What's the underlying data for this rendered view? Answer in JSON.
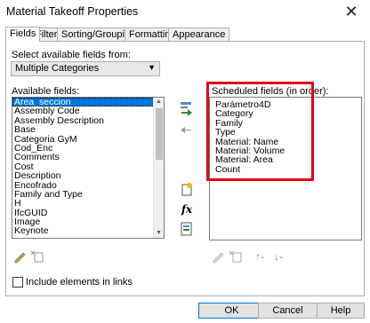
{
  "window": {
    "title": "Material Takeoff Properties",
    "close_glyph": "✕"
  },
  "tabs": [
    {
      "label": "Fields"
    },
    {
      "label": "Filter"
    },
    {
      "label": "Sorting/Grouping"
    },
    {
      "label": "Formatting"
    },
    {
      "label": "Appearance"
    }
  ],
  "fields": {
    "select_label": "Select available fields from:",
    "select_value": "Multiple Categories",
    "available_label": "Available fields:",
    "available_items": [
      "Area_seccion",
      "Assembly Code",
      "Assembly Description",
      "Base",
      "Categoria GyM",
      "Cod_Enc",
      "Comments",
      "Cost",
      "Description",
      "Encofrado",
      "Family and Type",
      "H",
      "IfcGUID",
      "Image",
      "Keynote"
    ],
    "scheduled_label": "Scheduled fields (in order):",
    "scheduled_items": [
      "Parámetro4D",
      "Category",
      "Family",
      "Type",
      "Material: Name",
      "Material: Volume",
      "Material: Area",
      "Count"
    ],
    "include_links_label": "Include elements in links"
  },
  "buttons": {
    "ok": "OK",
    "cancel": "Cancel",
    "help": "Help"
  },
  "colors": {
    "highlight": "#e0001a",
    "selection": "#0078d7"
  },
  "icons": {
    "add": "add-parameter-icon",
    "remove": "remove-parameter-icon",
    "new_param": "new-parameter-icon",
    "formula": "fx-icon",
    "combine": "combine-parameters-icon",
    "edit": "pencil-icon",
    "delete": "delete-icon",
    "move_up": "move-up-icon",
    "move_down": "move-down-icon"
  }
}
